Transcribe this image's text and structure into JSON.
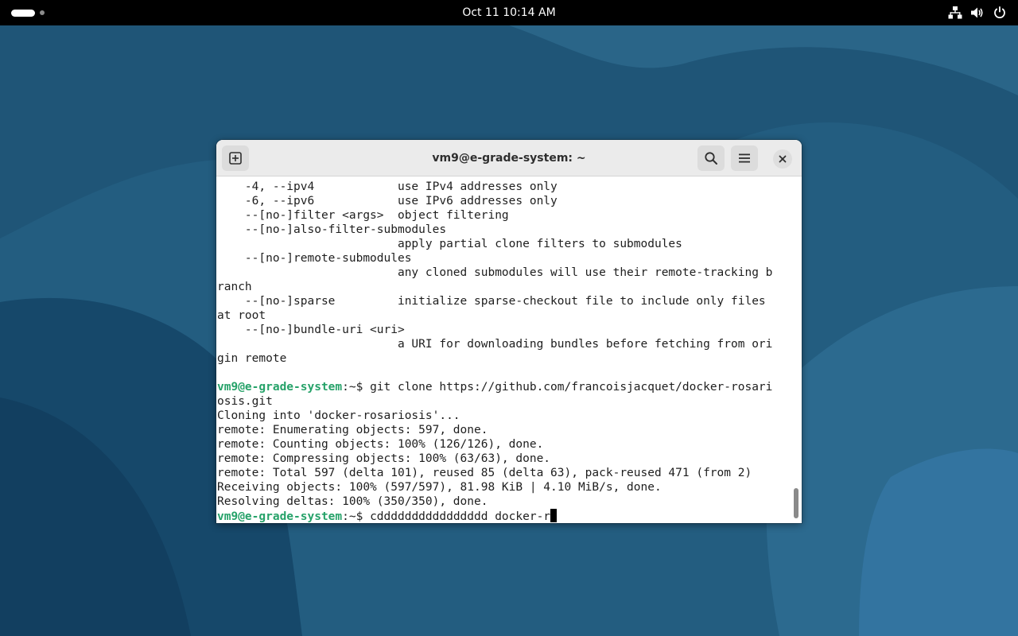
{
  "topbar": {
    "clock": "Oct 11  10:14 AM",
    "tray_icons": [
      "network-icon",
      "volume-icon",
      "power-icon"
    ]
  },
  "window": {
    "title": "vm9@e-grade-system: ~",
    "buttons": [
      "new-tab-icon",
      "search-icon",
      "hamburger-menu-icon",
      "close-icon"
    ]
  },
  "terminal": {
    "lines": [
      {
        "text": "    -4, --ipv4            use IPv4 addresses only"
      },
      {
        "text": "    -6, --ipv6            use IPv6 addresses only"
      },
      {
        "text": "    --[no-]filter <args>  object filtering"
      },
      {
        "text": "    --[no-]also-filter-submodules"
      },
      {
        "text": "                          apply partial clone filters to submodules"
      },
      {
        "text": "    --[no-]remote-submodules"
      },
      {
        "text": "                          any cloned submodules will use their remote-tracking b"
      },
      {
        "text": "ranch"
      },
      {
        "text": "    --[no-]sparse         initialize sparse-checkout file to include only files"
      },
      {
        "text": "at root"
      },
      {
        "text": "    --[no-]bundle-uri <uri>"
      },
      {
        "text": "                          a URI for downloading bundles before fetching from ori"
      },
      {
        "text": "gin remote"
      },
      {
        "text": ""
      },
      {
        "prompt_user": "vm9@e-grade-system",
        "prompt_path": ":~$ ",
        "text": "git clone https://github.com/francoisjacquet/docker-rosari"
      },
      {
        "text": "osis.git"
      },
      {
        "text": "Cloning into 'docker-rosariosis'..."
      },
      {
        "text": "remote: Enumerating objects: 597, done."
      },
      {
        "text": "remote: Counting objects: 100% (126/126), done."
      },
      {
        "text": "remote: Compressing objects: 100% (63/63), done."
      },
      {
        "text": "remote: Total 597 (delta 101), reused 85 (delta 63), pack-reused 471 (from 2)"
      },
      {
        "text": "Receiving objects: 100% (597/597), 81.98 KiB | 4.10 MiB/s, done."
      },
      {
        "text": "Resolving deltas: 100% (350/350), done."
      },
      {
        "prompt_user": "vm9@e-grade-system",
        "prompt_path": ":~$ ",
        "text": "cdddddddddddddddd docker-r",
        "cursor": true
      }
    ]
  },
  "colors": {
    "prompt_green": "#26a269",
    "wallpaper": "#205a7c",
    "topbar": "#000000"
  }
}
